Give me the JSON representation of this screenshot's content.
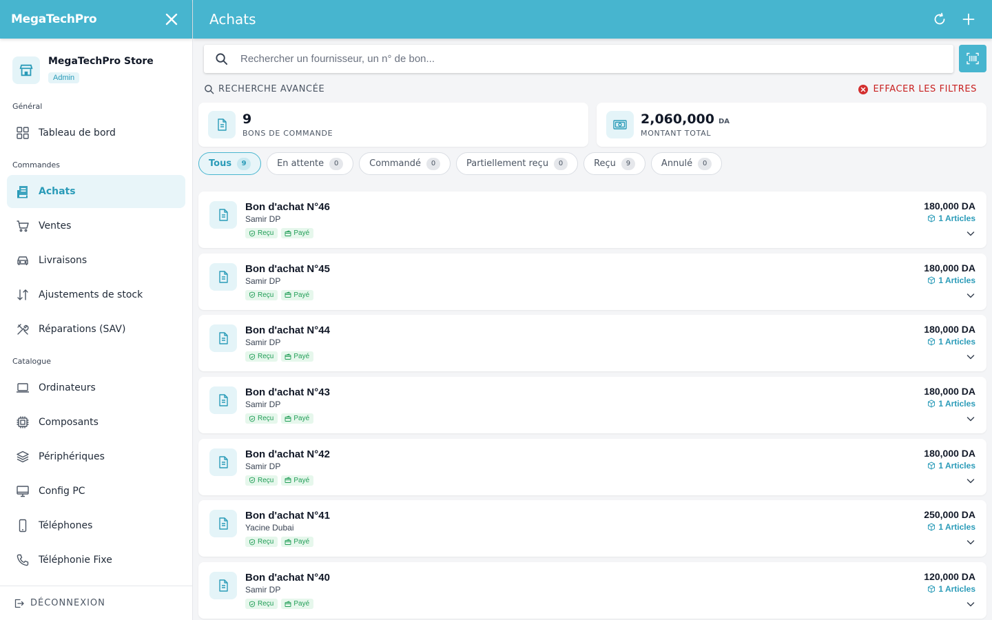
{
  "app": {
    "brand": "MegaTechPro",
    "store_name": "MegaTechPro Store",
    "store_role": "Admin",
    "accent_color": "#47b5cf",
    "close_icon": "close-icon"
  },
  "sidebar": {
    "sections": {
      "general": "Général",
      "orders": "Commandes",
      "catalog": "Catalogue"
    },
    "items": [
      {
        "label": "Tableau de bord",
        "icon": "dashboard-icon"
      },
      {
        "label": "Achats",
        "icon": "purchases-icon",
        "active": true
      },
      {
        "label": "Ventes",
        "icon": "cart-icon"
      },
      {
        "label": "Livraisons",
        "icon": "car-icon"
      },
      {
        "label": "Ajustements de stock",
        "icon": "arrows-icon"
      },
      {
        "label": "Réparations (SAV)",
        "icon": "tools-icon"
      },
      {
        "label": "Ordinateurs",
        "icon": "laptop-icon"
      },
      {
        "label": "Composants",
        "icon": "chip-icon"
      },
      {
        "label": "Périphériques",
        "icon": "layers-icon"
      },
      {
        "label": "Config PC",
        "icon": "monitor-icon"
      },
      {
        "label": "Téléphones",
        "icon": "phone-icon"
      },
      {
        "label": "Téléphonie Fixe",
        "icon": "landline-icon"
      }
    ],
    "logout": "DÉCONNEXION"
  },
  "header": {
    "title": "Achats",
    "refresh_icon": "refresh-icon",
    "add_icon": "plus-icon"
  },
  "search": {
    "placeholder": "Rechercher un fournisseur, un n° de bon...",
    "value": ""
  },
  "filters": {
    "advanced": "RECHERCHE AVANCÉE",
    "clear": "EFFACER LES FILTRES"
  },
  "stats": {
    "orders_count": "9",
    "orders_label": "BONS DE COMMANDE",
    "total_amount": "2,060,000",
    "total_unit": "DA",
    "total_label": "MONTANT TOTAL"
  },
  "tabs": [
    {
      "label": "Tous",
      "count": "9",
      "active": true
    },
    {
      "label": "En attente",
      "count": "0"
    },
    {
      "label": "Commandé",
      "count": "0"
    },
    {
      "label": "Partiellement reçu",
      "count": "0"
    },
    {
      "label": "Reçu",
      "count": "9"
    },
    {
      "label": "Annulé",
      "count": "0"
    }
  ],
  "orders": [
    {
      "title": "Bon d'achat N°46",
      "supplier": "Samir DP",
      "status": "Reçu",
      "payment": "Payé",
      "amount": "180,000 DA",
      "items": "1 Articles"
    },
    {
      "title": "Bon d'achat N°45",
      "supplier": "Samir DP",
      "status": "Reçu",
      "payment": "Payé",
      "amount": "180,000 DA",
      "items": "1 Articles"
    },
    {
      "title": "Bon d'achat N°44",
      "supplier": "Samir DP",
      "status": "Reçu",
      "payment": "Payé",
      "amount": "180,000 DA",
      "items": "1 Articles"
    },
    {
      "title": "Bon d'achat N°43",
      "supplier": "Samir DP",
      "status": "Reçu",
      "payment": "Payé",
      "amount": "180,000 DA",
      "items": "1 Articles"
    },
    {
      "title": "Bon d'achat N°42",
      "supplier": "Samir DP",
      "status": "Reçu",
      "payment": "Payé",
      "amount": "180,000 DA",
      "items": "1 Articles"
    },
    {
      "title": "Bon d'achat N°41",
      "supplier": "Yacine Dubai",
      "status": "Reçu",
      "payment": "Payé",
      "amount": "250,000 DA",
      "items": "1 Articles"
    },
    {
      "title": "Bon d'achat N°40",
      "supplier": "Samir DP",
      "status": "Reçu",
      "payment": "Payé",
      "amount": "120,000 DA",
      "items": "1 Articles"
    }
  ]
}
